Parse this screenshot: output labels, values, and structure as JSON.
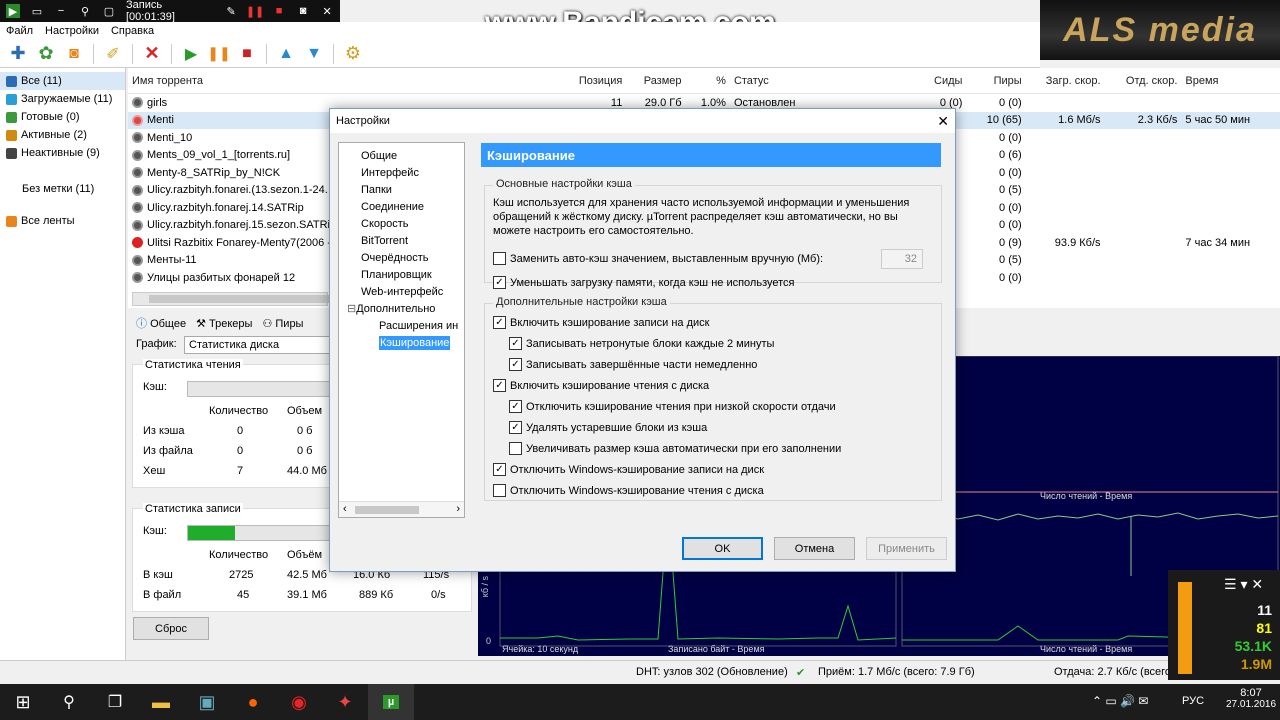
{
  "recorder": {
    "title": "Запись [00:01:39]"
  },
  "watermark": "www.Bandicam.com",
  "logo": "ALS media",
  "menu": [
    "Файл",
    "Настройки",
    "Справка"
  ],
  "sidebar": {
    "items": [
      {
        "label": "Все (11)",
        "color": "#2a6db5"
      },
      {
        "label": "Загружаемые (11)",
        "color": "#2a9fd6"
      },
      {
        "label": "Готовые (0)",
        "color": "#3a9a3a"
      },
      {
        "label": "Активные (2)",
        "color": "#d08a10"
      },
      {
        "label": "Неактивные (9)",
        "color": "#444444"
      }
    ],
    "nolabel": "Без метки (11)",
    "feeds": "Все ленты"
  },
  "torrents": {
    "headers": {
      "name": "Имя торрента",
      "pos": "Позиция",
      "size": "Размер",
      "pct": "%",
      "status": "Статус",
      "seeds": "Сиды",
      "peers": "Пиры",
      "dl": "Загр. скор.",
      "ul": "Отд. скор.",
      "eta": "Время"
    },
    "rows": [
      {
        "name": "girls",
        "pos": "11",
        "size": "29.0 Гб",
        "pct": "1.0%",
        "status": "Остановлен",
        "seeds": "0 (0)",
        "peers": "0 (0)",
        "dl": "",
        "ul": "",
        "eta": ""
      },
      {
        "name": "Menti",
        "pos": "",
        "size": "",
        "pct": "",
        "status": "",
        "seeds": "",
        "peers": "10 (65)",
        "dl": "1.6 Мб/s",
        "ul": "2.3 Кб/s",
        "eta": "5 час 50 мин"
      },
      {
        "name": "Menti_10",
        "pos": "",
        "size": "",
        "pct": "",
        "status": "",
        "seeds": "",
        "peers": "0 (0)",
        "dl": "",
        "ul": "",
        "eta": ""
      },
      {
        "name": "Ments_09_vol_1_[torrents.ru]",
        "pos": "",
        "size": "",
        "pct": "",
        "status": "",
        "seeds": "",
        "peers": "0 (6)",
        "dl": "",
        "ul": "",
        "eta": ""
      },
      {
        "name": "Menty-8_SATRip_by_N!CK",
        "pos": "",
        "size": "",
        "pct": "",
        "status": "",
        "seeds": "",
        "peers": "0 (0)",
        "dl": "",
        "ul": "",
        "eta": ""
      },
      {
        "name": "Ulicy.razbityh.fonarei.(13.sezon.1-24.",
        "pos": "",
        "size": "",
        "pct": "",
        "status": "",
        "seeds": "",
        "peers": "0 (5)",
        "dl": "",
        "ul": "",
        "eta": ""
      },
      {
        "name": "Ulicy.razbityh.fonarej.14.SATRip",
        "pos": "",
        "size": "",
        "pct": "",
        "status": "",
        "seeds": "",
        "peers": "0 (0)",
        "dl": "",
        "ul": "",
        "eta": ""
      },
      {
        "name": "Ulicy.razbityh.fonarej.15.sezon.SATRi",
        "pos": "",
        "size": "",
        "pct": "",
        "status": "",
        "seeds": "",
        "peers": "0 (0)",
        "dl": "",
        "ul": "",
        "eta": ""
      },
      {
        "name": "Ulitsi Razbitix Fonarey-Menty7(2006 -",
        "pos": "",
        "size": "",
        "pct": "",
        "status": "",
        "seeds": "",
        "peers": "0 (9)",
        "dl": "93.9 Кб/s",
        "ul": "",
        "eta": "7 час 34 мин"
      },
      {
        "name": "Менты-11",
        "pos": "",
        "size": "",
        "pct": "",
        "status": "",
        "seeds": "",
        "peers": "0 (5)",
        "dl": "",
        "ul": "",
        "eta": ""
      },
      {
        "name": "Улицы разбитых фонарей 12",
        "pos": "",
        "size": "",
        "pct": "",
        "status": "",
        "seeds": "",
        "peers": "0 (0)",
        "dl": "",
        "ul": "",
        "eta": ""
      }
    ]
  },
  "bottom": {
    "tabs": [
      "Общее",
      "Трекеры",
      "Пиры"
    ],
    "graph_label": "График:",
    "graph_select": "Статистика диска",
    "read_title": "Статистика чтения",
    "write_title": "Статистика записи",
    "cache_label": "Кэш:",
    "col_count": "Количество",
    "col_volume": "Объем",
    "col_volume2": "Объём",
    "read_rows": [
      {
        "label": "Из кэша",
        "count": "0",
        "vol": "0 б"
      },
      {
        "label": "Из файла",
        "count": "0",
        "vol": "0 б"
      },
      {
        "label": "Хеш",
        "count": "7",
        "vol": "44.0 Мб"
      }
    ],
    "write_rows": [
      {
        "label": "В кэш",
        "count": "2725",
        "vol": "42.5 Мб",
        "x": "16.0 Кб",
        "rate": "115/s"
      },
      {
        "label": "В файл",
        "count": "45",
        "vol": "39.1 Мб",
        "x": "889 Кб",
        "rate": "0/s"
      }
    ],
    "write_cache_fill": 0.32,
    "reset": "Сброс"
  },
  "graph": {
    "label_reads": "Число чтений - Время",
    "label_written": "Записано байт - Время",
    "label_reads2": "Число чтений - Время",
    "label_cell": "Ячейка: 10 секунд",
    "axis_zero": "0",
    "axis_kb": "кб / s"
  },
  "status": {
    "dht": "DHT: узлов 302 (Обновление)",
    "recv": "Приём: 1.7 Мб/с (всего: 7.9 Гб)",
    "send": "Отдача: 2.7 Кб/с (всего: 16.1 Мб)"
  },
  "overlay": {
    "v1": "11",
    "v2": "81",
    "v3": "53.1K",
    "v4": "1.9M"
  },
  "tray": {
    "lang": "РУС",
    "time": "8:07",
    "date": "27.01.2016"
  },
  "dialog": {
    "title": "Настройки",
    "tree": [
      {
        "label": "Общие",
        "level": 1
      },
      {
        "label": "Интерфейс",
        "level": 1
      },
      {
        "label": "Папки",
        "level": 1
      },
      {
        "label": "Соединение",
        "level": 1
      },
      {
        "label": "Скорость",
        "level": 1
      },
      {
        "label": "BitTorrent",
        "level": 1
      },
      {
        "label": "Очерёдность",
        "level": 1
      },
      {
        "label": "Планировщик",
        "level": 1
      },
      {
        "label": "Web-интерфейс",
        "level": 1
      },
      {
        "label": "Дополнительно",
        "level": 0
      },
      {
        "label": "Расширения ин",
        "level": 2
      },
      {
        "label": "Кэширование",
        "level": 2,
        "selected": true
      }
    ],
    "pane_title": "Кэширование",
    "basic_title": "Основные настройки кэша",
    "basic_desc": "Кэш используется для хранения часто используемой информации и уменьшения обращений к жёсткому диску. µTorrent распределяет кэш автоматически, но вы можете настроить его самостоятельно.",
    "override_label": "Заменить авто-кэш значением, выставленным вручную (Мб):",
    "override_value": "32",
    "reduce_label": "Уменьшать загрузку памяти, когда кэш не используется",
    "adv_title": "Дополнительные настройки кэша",
    "options": [
      {
        "label": "Включить кэширование записи на диск",
        "checked": true,
        "indent": 0
      },
      {
        "label": "Записывать нетронутые блоки каждые 2 минуты",
        "checked": true,
        "indent": 1
      },
      {
        "label": "Записывать завершённые части немедленно",
        "checked": true,
        "indent": 1
      },
      {
        "label": "Включить кэширование чтения с диска",
        "checked": true,
        "indent": 0
      },
      {
        "label": "Отключить кэширование чтения при низкой скорости отдачи",
        "checked": true,
        "indent": 1
      },
      {
        "label": "Удалять устаревшие блоки из кэша",
        "checked": true,
        "indent": 1
      },
      {
        "label": "Увеличивать размер кэша автоматически при его заполнении",
        "checked": false,
        "indent": 1
      },
      {
        "label": "Отключить Windows-кэширование записи на диск",
        "checked": true,
        "indent": 0
      },
      {
        "label": "Отключить Windows-кэширование чтения с диска",
        "checked": false,
        "indent": 0
      }
    ],
    "ok": "OK",
    "cancel": "Отмена",
    "apply": "Применить"
  }
}
